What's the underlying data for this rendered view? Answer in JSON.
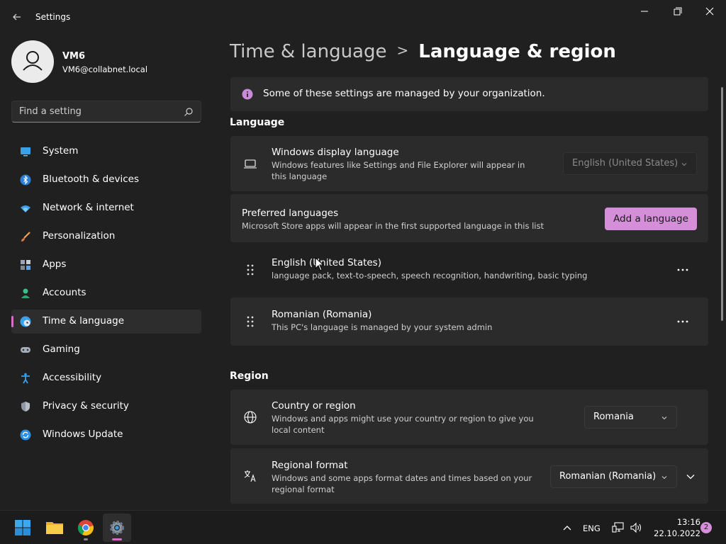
{
  "window": {
    "title": "Settings",
    "back_icon": "back-arrow-icon",
    "controls": [
      "minimize-icon",
      "maximize-icon",
      "close-icon"
    ]
  },
  "profile": {
    "name": "VM6",
    "email": "VM6@collabnet.local"
  },
  "search": {
    "placeholder": "Find a setting"
  },
  "sidebar": {
    "items": [
      {
        "label": "System",
        "icon": "system-icon"
      },
      {
        "label": "Bluetooth & devices",
        "icon": "bluetooth-icon"
      },
      {
        "label": "Network & internet",
        "icon": "wifi-icon"
      },
      {
        "label": "Personalization",
        "icon": "brush-icon"
      },
      {
        "label": "Apps",
        "icon": "apps-icon"
      },
      {
        "label": "Accounts",
        "icon": "accounts-icon"
      },
      {
        "label": "Time & language",
        "icon": "time-language-icon",
        "selected": true
      },
      {
        "label": "Gaming",
        "icon": "gamepad-icon"
      },
      {
        "label": "Accessibility",
        "icon": "accessibility-icon"
      },
      {
        "label": "Privacy & security",
        "icon": "shield-icon"
      },
      {
        "label": "Windows Update",
        "icon": "update-icon"
      }
    ]
  },
  "breadcrumb": {
    "parent": "Time & language",
    "separator": ">",
    "current": "Language & region"
  },
  "managed_banner": {
    "text": "Some of these settings are managed by your organization.",
    "icon": "info-icon"
  },
  "language": {
    "section_label": "Language",
    "display_language": {
      "title": "Windows display language",
      "description": "Windows features like Settings and File Explorer will appear in this language",
      "value": "English (United States)",
      "icon": "laptop-icon"
    },
    "preferred": {
      "title": "Preferred languages",
      "description": "Microsoft Store apps will appear in the first supported language in this list",
      "add_button": "Add a language"
    },
    "languages": [
      {
        "name": "English (United States)",
        "details": "language pack, text-to-speech, speech recognition, handwriting, basic typing"
      },
      {
        "name": "Romanian (Romania)",
        "details": "This PC's language is managed by your system admin"
      }
    ]
  },
  "region": {
    "section_label": "Region",
    "country": {
      "title": "Country or region",
      "description": "Windows and apps might use your country or region to give you local content",
      "value": "Romania",
      "icon": "globe-icon"
    },
    "format": {
      "title": "Regional format",
      "description": "Windows and some apps format dates and times based on your regional format",
      "value": "Romanian (Romania)",
      "icon": "regional-format-icon"
    }
  },
  "taskbar": {
    "apps": [
      "start-icon",
      "file-explorer-icon",
      "chrome-icon",
      "settings-icon"
    ],
    "language": "ENG",
    "time": "13:16",
    "date": "22.10.2022",
    "notification_count": "2"
  },
  "colors": {
    "accent": "#d48fd8",
    "background": "#202020",
    "card": "#2b2b2b"
  }
}
